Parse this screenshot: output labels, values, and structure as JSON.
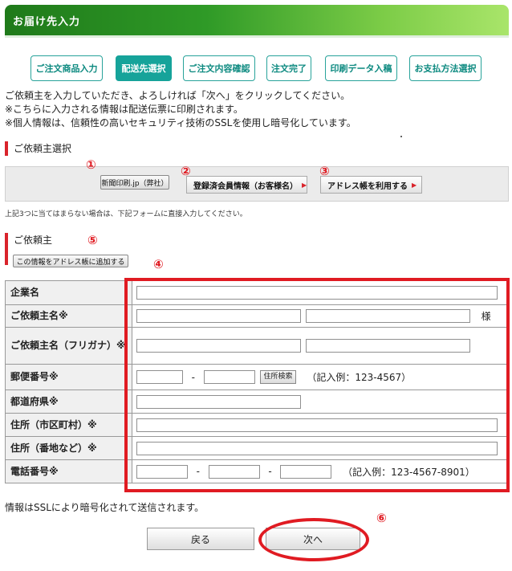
{
  "header": {
    "title": "お届け先入力"
  },
  "steps": [
    {
      "label": "ご注文商品入力",
      "active": false
    },
    {
      "label": "配送先選択",
      "active": true
    },
    {
      "label": "ご注文内容確認",
      "active": false
    },
    {
      "label": "注文完了",
      "active": false
    },
    {
      "label": "印刷データ入稿",
      "active": false
    },
    {
      "label": "お支払方法選択",
      "active": false
    }
  ],
  "intro": [
    "ご依頼主を入力していただき、よろしければ「次へ」をクリックしてください。",
    "※こちらに入力される情報は配送伝票に印刷されます。",
    "※個人情報は、信頼性の高いセキュリティ技術のSSLを使用し暗号化しています。"
  ],
  "requester_select": {
    "heading": "ご依頼主選択",
    "own_company_button": "新聞印刷.jp（弊社）",
    "registered_member_button": "登録済会員情報（お客様名）",
    "address_book_button": "アドレス帳を利用する",
    "note": "上記3つに当てはまらない場合は、下記フォームに直接入力してください。"
  },
  "requester": {
    "heading": "ご依頼主",
    "add_to_address_book_button": "この情報をアドレス帳に追加する"
  },
  "annotations": [
    "①",
    "②",
    "③",
    "④",
    "⑤",
    "⑥"
  ],
  "form": {
    "company_label": "企業名",
    "name_label": "ご依頼主名※",
    "name_suffix": "様",
    "kana_label": "ご依頼主名（フリガナ）※",
    "zip_label": "郵便番号※",
    "zip_separator": "-",
    "zip_search_button": "住所検索",
    "zip_hint": "（記入例：123-4567）",
    "prefecture_label": "都道府県※",
    "city_label": "住所（市区町村）※",
    "street_label": "住所（番地など）※",
    "phone_label": "電話番号※",
    "phone_separator": "-",
    "phone_hint": "（記入例：123-4567-8901）"
  },
  "ssl_note": "情報はSSLにより暗号化されて送信されます。",
  "nav": {
    "back_label": "戻る",
    "next_label": "次へ"
  },
  "colors": {
    "accent_red": "#e01b22",
    "step_teal": "#16a39a",
    "header_green": "#2f9a27"
  }
}
